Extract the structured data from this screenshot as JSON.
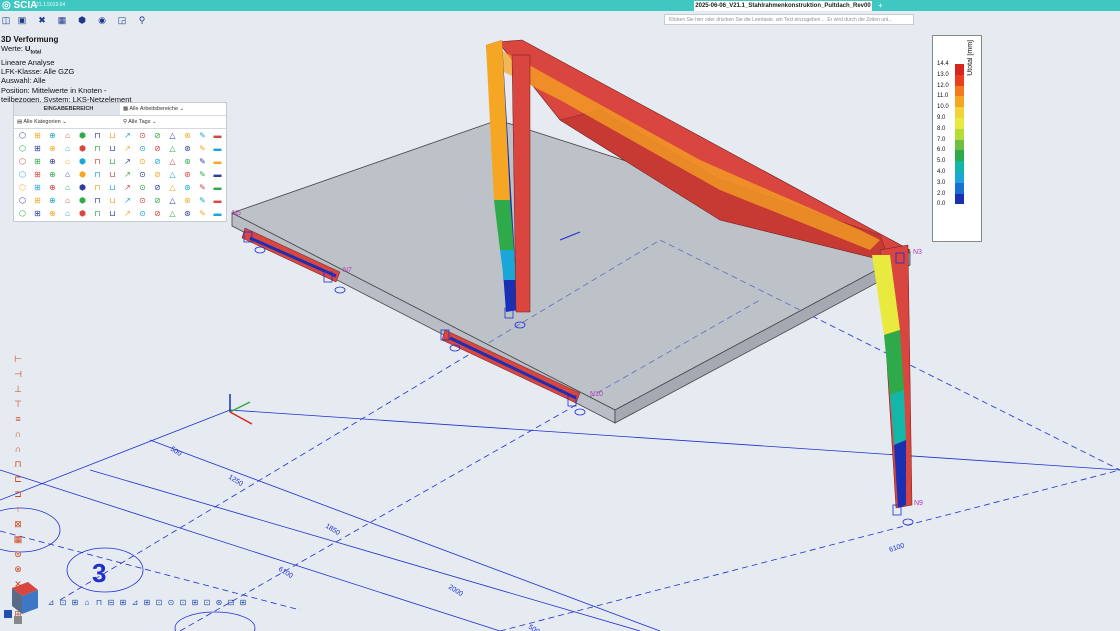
{
  "app": {
    "brand": "SCIA",
    "version": "21.1.5019.64"
  },
  "document_tab": {
    "title": "2025-06-06_V21.1_Stahlrahmenkonstruktion_Pultdach_Rev00",
    "add": "+"
  },
  "command_line": {
    "placeholder": "Klicken Sie hier oder drücken Sie die Leertaste, um Text einzugeben ... Er wird durch die Zeilen unt..."
  },
  "info": {
    "title": "3D Verformung",
    "werte_label": "Werte:",
    "werte_value": "U",
    "werte_sub": "total",
    "line1": "Lineare  Analyse",
    "line2": "LFK-Klasse:  Alle GZG",
    "line3": "Auswahl:  Alle",
    "line4": "Position:  Mittelwerte  in Knoten -",
    "line5": "teilbezogen. System:  LKS-Netzelement"
  },
  "panel": {
    "header": "EINGABEBEREICH",
    "arbeitsbereiche": "Alle Arbeitsbereiche",
    "kategorien": "Alle Kategorien",
    "tags": "Alle Tags"
  },
  "legend": {
    "title": "Utotal [mm]",
    "values": [
      "14.4",
      "13.0",
      "12.0",
      "11.0",
      "10.0",
      "9.0",
      "8.0",
      "7.0",
      "6.0",
      "5.0",
      "4.0",
      "3.0",
      "2.0",
      "0.0"
    ],
    "colors": [
      "#d7261e",
      "#e8401f",
      "#f47a20",
      "#f5a623",
      "#f2d43a",
      "#e8ea3f",
      "#b6dc3a",
      "#6dc041",
      "#2eaa4a",
      "#13b7a8",
      "#1ba6d8",
      "#1b6fd1",
      "#1b2fb3",
      "#1b1690"
    ]
  },
  "model": {
    "nodes": [
      "N3",
      "N7",
      "N10",
      "N9",
      "N5"
    ],
    "dimensions": [
      "500",
      "1250",
      "1850",
      "6100",
      "2000",
      "6100",
      "500"
    ],
    "grid_label": "3"
  },
  "colors": {
    "accent": "#3fc7c2",
    "beam": "#d9453f",
    "grid": "#1e2fd0"
  }
}
